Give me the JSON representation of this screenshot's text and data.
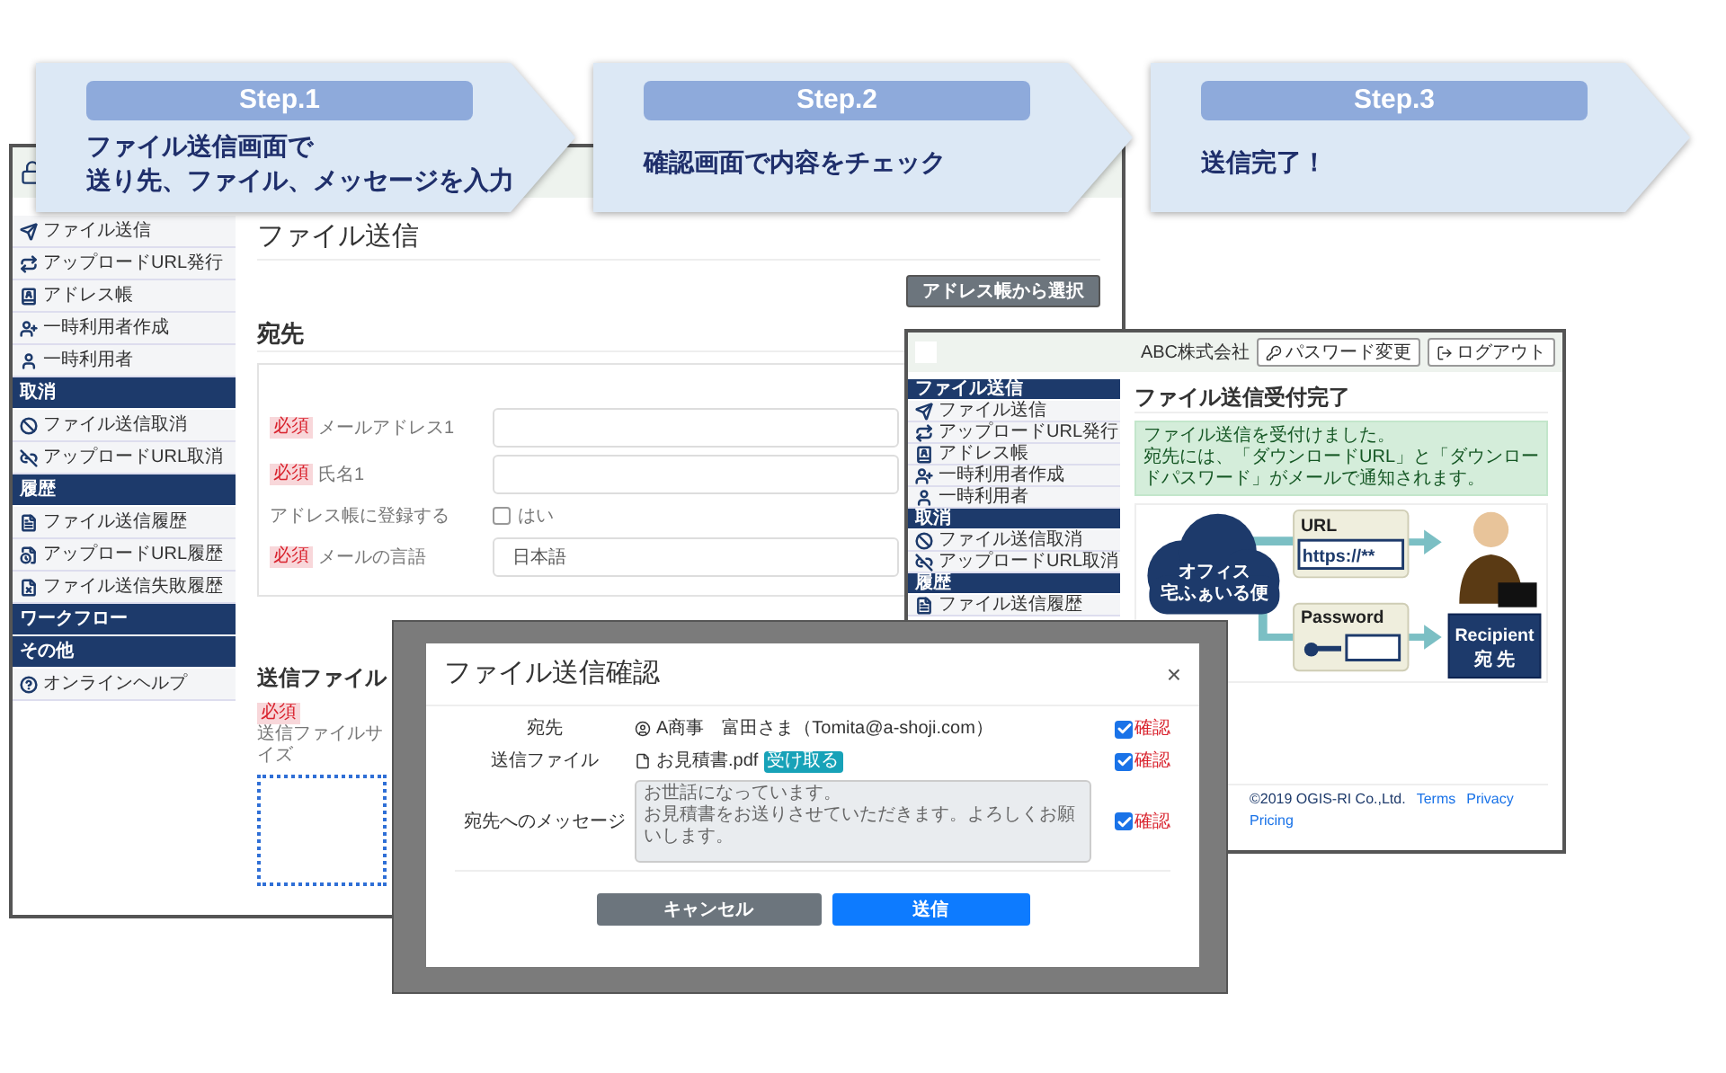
{
  "steps": [
    {
      "label": "Step.1",
      "lines": [
        "ファイル送信画面で",
        "送り先、ファイル、メッセージを入力"
      ]
    },
    {
      "label": "Step.2",
      "lines": [
        "確認画面で内容をチェック"
      ]
    },
    {
      "label": "Step.3",
      "lines": [
        "送信完了！"
      ]
    }
  ],
  "left_window": {
    "sidebar": [
      {
        "kind": "item",
        "label": "ファイル送信"
      },
      {
        "kind": "item",
        "label": "アップロードURL発行"
      },
      {
        "kind": "item",
        "label": "アドレス帳"
      },
      {
        "kind": "item",
        "label": "一時利用者作成"
      },
      {
        "kind": "item",
        "label": "一時利用者"
      },
      {
        "kind": "header",
        "label": "取消"
      },
      {
        "kind": "item",
        "label": "ファイル送信取消"
      },
      {
        "kind": "item",
        "label": "アップロードURL取消"
      },
      {
        "kind": "header",
        "label": "履歴"
      },
      {
        "kind": "item",
        "label": "ファイル送信履歴"
      },
      {
        "kind": "item",
        "label": "アップロードURL履歴"
      },
      {
        "kind": "item",
        "label": "ファイル送信失敗履歴"
      },
      {
        "kind": "header",
        "label": "ワークフロー"
      },
      {
        "kind": "header",
        "label": "その他"
      },
      {
        "kind": "item",
        "label": "オンラインヘルプ"
      }
    ],
    "title": "ファイル送信",
    "address_button": "アドレス帳から選択",
    "recipient_heading": "宛先",
    "form": [
      {
        "kind": "input",
        "badge": "必須",
        "label": "メールアドレス1"
      },
      {
        "kind": "input",
        "badge": "必須",
        "label": "氏名1"
      },
      {
        "kind": "checkbox",
        "label": "アドレス帳に登録する",
        "option": "はい",
        "checked": false
      },
      {
        "kind": "select",
        "badge": "必須",
        "label": "メールの言語",
        "value": "日本語"
      }
    ],
    "file_heading": "送信ファイル",
    "file_note": {
      "badge": "必須",
      "text": "送信ファイルサイズ"
    }
  },
  "right_window": {
    "company": "ABC株式会社",
    "buttons": [
      "パスワード変更",
      "ログアウト"
    ],
    "sidebar": [
      {
        "kind": "header",
        "label": "ファイル送信"
      },
      {
        "kind": "item",
        "label": "ファイル送信"
      },
      {
        "kind": "item",
        "label": "アップロードURL発行"
      },
      {
        "kind": "item",
        "label": "アドレス帳"
      },
      {
        "kind": "item",
        "label": "一時利用者作成"
      },
      {
        "kind": "item",
        "label": "一時利用者"
      },
      {
        "kind": "header",
        "label": "取消"
      },
      {
        "kind": "item",
        "label": "ファイル送信取消"
      },
      {
        "kind": "item",
        "label": "アップロードURL取消"
      },
      {
        "kind": "header",
        "label": "履歴"
      },
      {
        "kind": "item",
        "label": "ファイル送信履歴"
      }
    ],
    "title": "ファイル送信受付完了",
    "alert": [
      "ファイル送信を受付けました。",
      "宛先には、「ダウンロードURL」と「ダウンロードパスワード」がメールで通知されます。"
    ],
    "diagram": {
      "cloud_lines": [
        "オフィス",
        "宅ふぁいる便"
      ],
      "url_label": "URL",
      "url_value": "https://**",
      "password_label": "Password",
      "recipient_lines": [
        "Recipient",
        "宛 先"
      ]
    },
    "footer": {
      "copyright": "©2019 OGIS-RI Co.,Ltd.",
      "links": [
        "Terms",
        "Privacy",
        "Pricing"
      ]
    }
  },
  "dialog": {
    "title": "ファイル送信確認",
    "close": "×",
    "rows": [
      {
        "kind": "recipient",
        "label": "宛先",
        "value": "A商事　富田さま（Tomita@a-shoji.com）",
        "confirm": "確認",
        "checked": true
      },
      {
        "kind": "file",
        "label": "送信ファイル",
        "value": "お見積書.pdf",
        "badge": "受け取る",
        "confirm": "確認",
        "checked": true
      },
      {
        "kind": "message",
        "label": "宛先へのメッセージ",
        "lines": [
          "お世話になっています。",
          "お見積書をお送りさせていただきます。よろしくお願いします。"
        ],
        "confirm": "確認",
        "checked": true
      }
    ],
    "buttons": [
      {
        "kind": "secondary",
        "label": "キャンセル"
      },
      {
        "kind": "primary",
        "label": "送信"
      }
    ]
  }
}
